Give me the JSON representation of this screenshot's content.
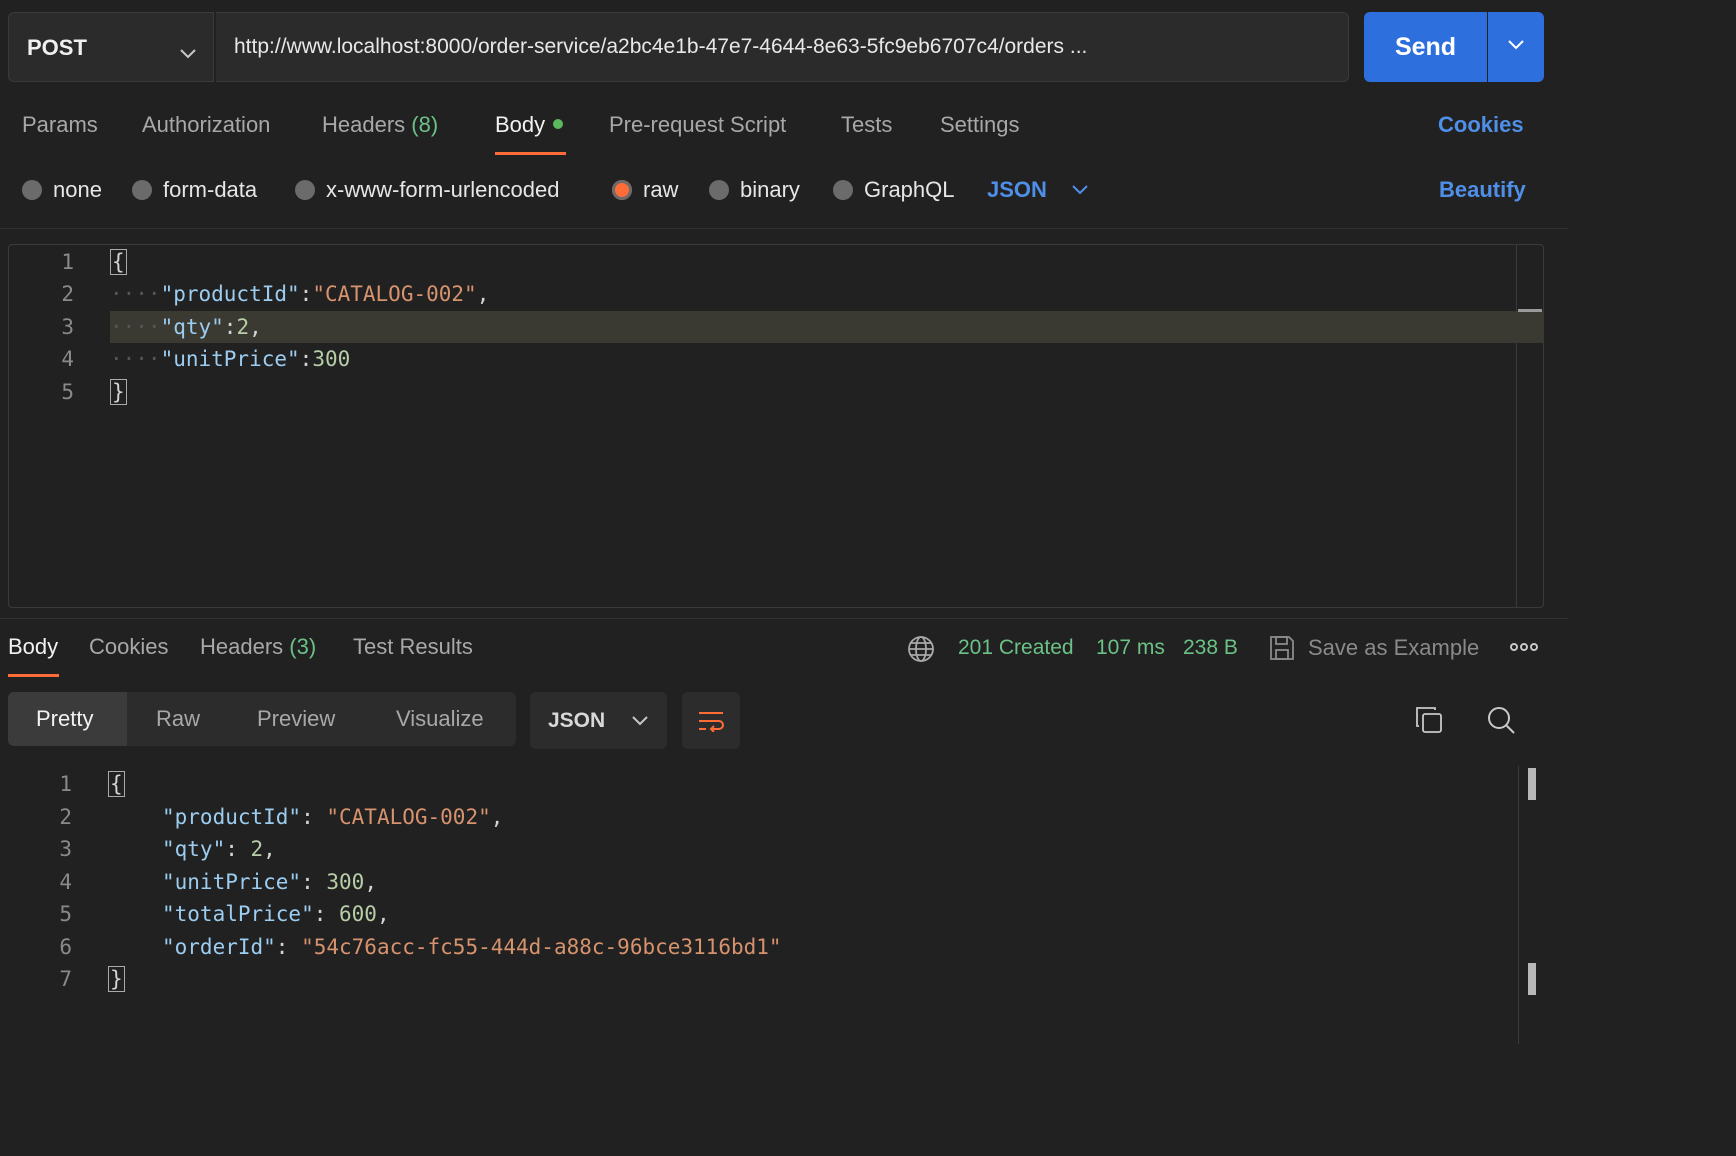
{
  "request": {
    "method": "POST",
    "url": "http://www.localhost:8000/order-service/a2bc4e1b-47e7-4644-8e63-5fc9eb6707c4/orders ...",
    "send_label": "Send"
  },
  "request_tabs": {
    "params": "Params",
    "authorization": "Authorization",
    "headers": "Headers",
    "headers_count": "(8)",
    "body": "Body",
    "pre_request": "Pre-request Script",
    "tests": "Tests",
    "settings": "Settings",
    "cookies": "Cookies"
  },
  "body_types": {
    "none": "none",
    "form_data": "form-data",
    "urlencoded": "x-www-form-urlencoded",
    "raw": "raw",
    "binary": "binary",
    "graphql": "GraphQL",
    "selected": "raw",
    "language": "JSON",
    "beautify": "Beautify"
  },
  "request_body": {
    "line_numbers": [
      "1",
      "2",
      "3",
      "4",
      "5"
    ],
    "open_brace": "{",
    "close_brace": "}",
    "fields": [
      {
        "key": "\"productId\"",
        "value": "\"CATALOG-002\"",
        "trail": ","
      },
      {
        "key": "\"qty\"",
        "value": "2",
        "trail": ","
      },
      {
        "key": "\"unitPrice\"",
        "value": "300",
        "trail": ""
      }
    ],
    "highlighted_line": 3
  },
  "response_tabs": {
    "body": "Body",
    "cookies": "Cookies",
    "headers": "Headers",
    "headers_count": "(3)",
    "test_results": "Test Results"
  },
  "response_status": {
    "status": "201 Created",
    "time": "107 ms",
    "size": "238 B",
    "save_example": "Save as Example"
  },
  "response_view": {
    "pretty": "Pretty",
    "raw": "Raw",
    "preview": "Preview",
    "visualize": "Visualize",
    "format": "JSON"
  },
  "response_body": {
    "line_numbers": [
      "1",
      "2",
      "3",
      "4",
      "5",
      "6",
      "7"
    ],
    "open_brace": "{",
    "close_brace": "}",
    "fields": [
      {
        "key": "\"productId\"",
        "value": "\"CATALOG-002\"",
        "trail": ","
      },
      {
        "key": "\"qty\"",
        "value": "2",
        "trail": ","
      },
      {
        "key": "\"unitPrice\"",
        "value": "300",
        "trail": ","
      },
      {
        "key": "\"totalPrice\"",
        "value": "600",
        "trail": ","
      },
      {
        "key": "\"orderId\"",
        "value": "\"54c76acc-fc55-444d-a88c-96bce3116bd1\"",
        "trail": ""
      }
    ]
  },
  "colors": {
    "accent": "#ff6c37",
    "send_button": "#2d6fdc",
    "link": "#4f8fe8",
    "success": "#6cc286"
  },
  "icons": [
    "chevron-down-icon",
    "globe-icon",
    "save-icon",
    "more-icon",
    "wrap-icon",
    "copy-icon",
    "search-icon"
  ]
}
